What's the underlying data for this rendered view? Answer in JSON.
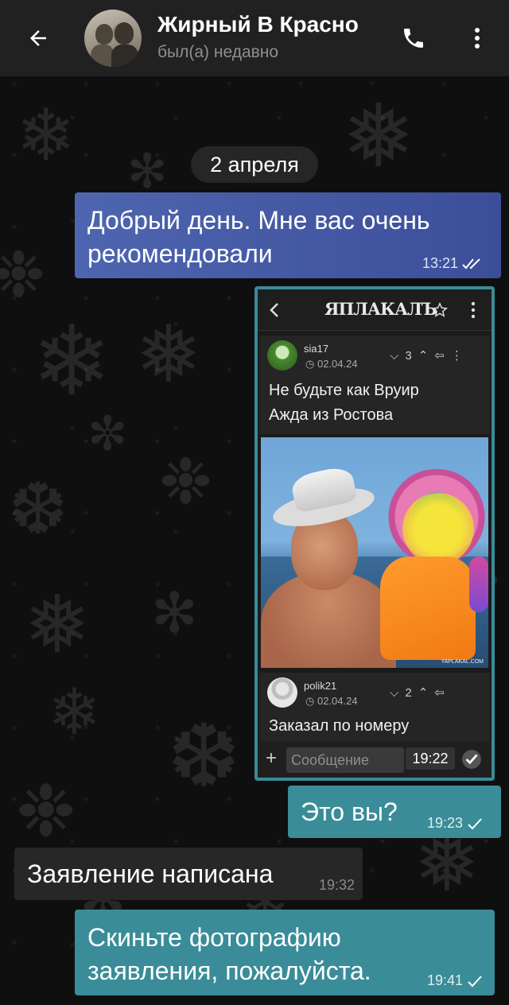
{
  "header": {
    "contact_name": "Жирный В Красно",
    "contact_status": "был(а) недавно"
  },
  "chat": {
    "date_divider": "2 апреля",
    "messages": [
      {
        "id": "m1",
        "direction": "out",
        "text_lines": [
          "Добрый день. Мне вас очень",
          "рекомендовали"
        ],
        "time": "13:21",
        "status": "read"
      },
      {
        "id": "m2",
        "direction": "out",
        "type": "image",
        "time": "19:22"
      },
      {
        "id": "m3",
        "direction": "out",
        "text_lines": [
          "Это вы?"
        ],
        "time": "19:23",
        "status": "sent"
      },
      {
        "id": "m4",
        "direction": "in",
        "text_lines": [
          "Заявление написана"
        ],
        "time": "19:32"
      },
      {
        "id": "m5",
        "direction": "out",
        "text_lines": [
          "Скиньте фотографию",
          "заявления, пожалуйста."
        ],
        "time": "19:41",
        "status": "sent"
      }
    ]
  },
  "screenshot": {
    "site_logo": "ЯПЛАКАЛЪ",
    "post1": {
      "username": "sia17",
      "date": "02.04.24",
      "rating": "3",
      "text_lines": [
        "Не будьте как Вруир",
        "Ажда из Ростова"
      ]
    },
    "watermark": "YAPLAKAL.COM",
    "post2": {
      "username": "polik21",
      "date": "02.04.24",
      "rating": "2",
      "text_lines": [
        "Заказал по номеру"
      ]
    },
    "input_placeholder": "Сообщение",
    "time": "19:22"
  },
  "colors": {
    "header_bg": "#212121",
    "bubble_blue_start": "#4e65b0",
    "bubble_blue_end": "#3c4e99",
    "bubble_teal": "#3a8c98",
    "bubble_incoming": "#272727"
  }
}
